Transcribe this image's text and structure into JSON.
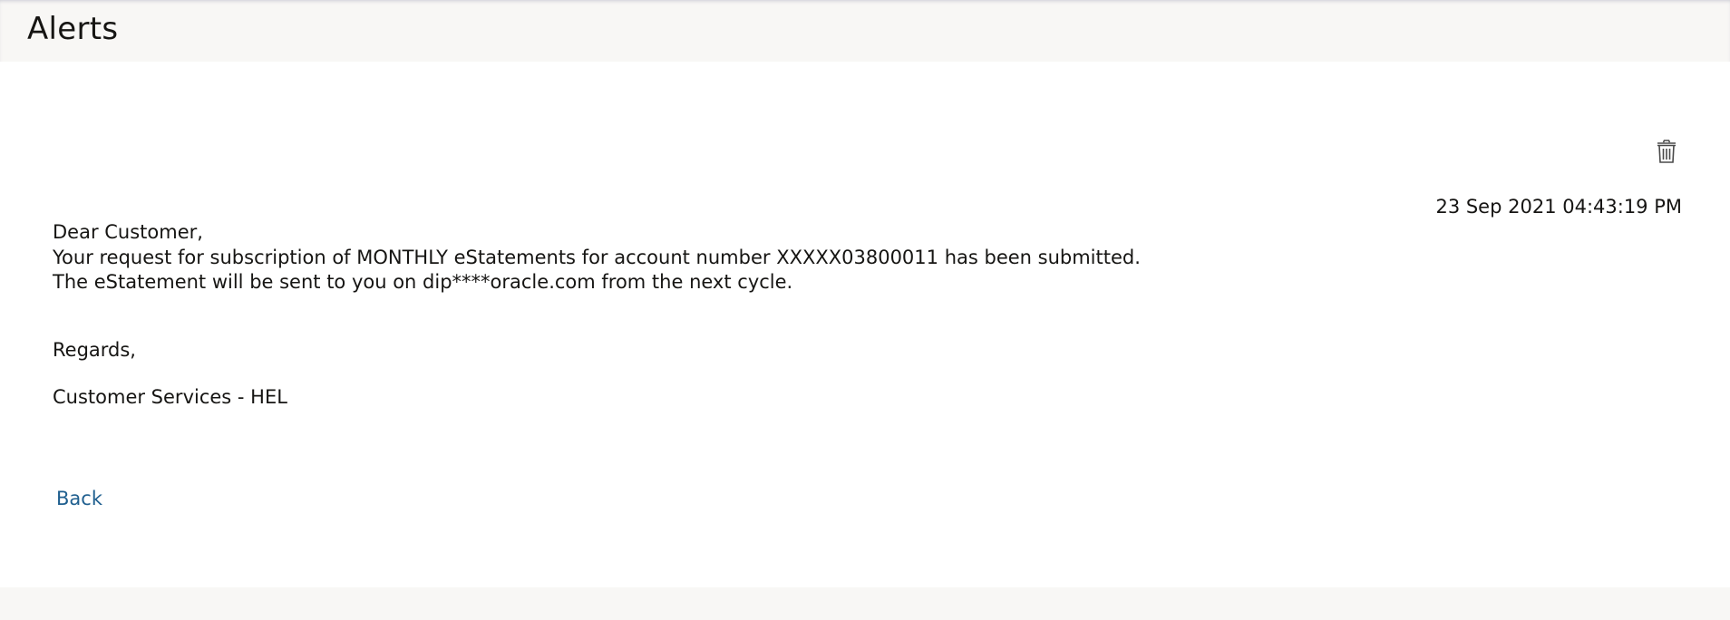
{
  "header": {
    "title": "Alerts"
  },
  "alert": {
    "timestamp": "23 Sep 2021 04:43:19 PM",
    "greeting": "Dear Customer,",
    "body_line_1": "Your request for subscription of MONTHLY eStatements for account number XXXXX03800011 has been submitted.",
    "body_line_2": "The eStatement will be sent to you on dip****oracle.com from the next cycle.",
    "regards": "Regards,",
    "signature": "Customer Services - HEL",
    "delete_icon": "trash-icon"
  },
  "actions": {
    "back_label": "Back"
  },
  "colors": {
    "page_background": "#f8f7f5",
    "content_background": "#ffffff",
    "text": "#161513",
    "link": "#1f5f8f"
  }
}
